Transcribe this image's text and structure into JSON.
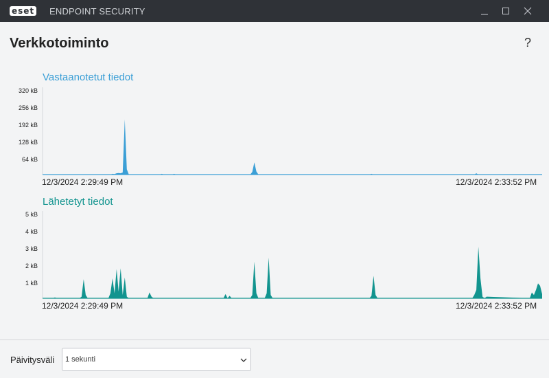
{
  "window": {
    "logo_text": "eset",
    "app_title": "ENDPOINT SECURITY",
    "controls": [
      "minimize-icon",
      "maximize-icon",
      "close-icon"
    ]
  },
  "page": {
    "title": "Verkkotoiminto",
    "help_label": "?"
  },
  "colors": {
    "titlebar": "#2f3237",
    "received": "#3b9fd6",
    "sent": "#12948f"
  },
  "chart_data": [
    {
      "type": "area",
      "title": "Vastaanotetut tiedot",
      "y_unit": "kB",
      "yticks": [
        "320 kB",
        "256 kB",
        "192 kB",
        "128 kB",
        "64 kB"
      ],
      "ytick_values": [
        320,
        256,
        192,
        128,
        64
      ],
      "ylim": [
        0,
        320
      ],
      "xlim": [
        0,
        243
      ],
      "x_start_label": "12/3/2024 2:29:49 PM",
      "x_end_label": "12/3/2024 2:33:52 PM",
      "x": [
        0,
        14,
        15,
        16,
        19,
        20,
        21,
        33,
        34,
        35,
        36,
        37,
        38,
        39,
        40,
        41,
        42,
        43,
        57,
        58,
        59,
        63,
        64,
        65,
        101,
        102,
        103,
        104,
        105,
        159,
        160,
        161,
        210,
        211,
        212,
        243
      ],
      "values": [
        0,
        0,
        1,
        0,
        0,
        1,
        0,
        0,
        3,
        2,
        5,
        6,
        5,
        8,
        212,
        20,
        0,
        0,
        0,
        3,
        0,
        0,
        3,
        0,
        0,
        10,
        47,
        12,
        0,
        0,
        3,
        0,
        0,
        5,
        0,
        0
      ]
    },
    {
      "type": "area",
      "title": "Lähetetyt tiedot",
      "y_unit": "kB",
      "yticks": [
        "5 kB",
        "4 kB",
        "3 kB",
        "2 kB",
        "1 kB"
      ],
      "ytick_values": [
        5,
        4,
        3,
        2,
        1
      ],
      "ylim": [
        0,
        5
      ],
      "xlim": [
        0,
        243
      ],
      "x_start_label": "12/3/2024 2:29:49 PM",
      "x_end_label": "12/3/2024 2:33:52 PM",
      "x": [
        0,
        5,
        6,
        7,
        18,
        19,
        20,
        21,
        22,
        23,
        32,
        33,
        34,
        35,
        36,
        37,
        38,
        39,
        40,
        41,
        42,
        43,
        51,
        52,
        53,
        54,
        88,
        89,
        90,
        91,
        92,
        101,
        102,
        103,
        104,
        105,
        108,
        109,
        110,
        111,
        112,
        159,
        160,
        161,
        162,
        163,
        209,
        210,
        211,
        212,
        213,
        214,
        215,
        216,
        237,
        238,
        239,
        240,
        241,
        242,
        243
      ],
      "values": [
        0,
        0,
        0.05,
        0,
        0,
        0.1,
        1.15,
        0.2,
        0,
        0,
        0,
        0.3,
        1.2,
        0.3,
        1.75,
        0.4,
        1.8,
        0.2,
        1.25,
        0.1,
        0,
        0,
        0,
        0.35,
        0.1,
        0,
        0,
        0.25,
        0,
        0.15,
        0,
        0,
        0.2,
        2.2,
        0.3,
        0,
        0,
        0.3,
        2.45,
        0.2,
        0,
        0,
        0.15,
        1.35,
        0.2,
        0,
        0,
        0.2,
        0.5,
        3.1,
        1.2,
        0.1,
        0,
        0.1,
        0,
        0.35,
        0.2,
        0.5,
        0.9,
        0.75,
        0.25
      ]
    }
  ],
  "footer": {
    "label": "Päivitysväli",
    "select_value": "1 sekunti"
  }
}
